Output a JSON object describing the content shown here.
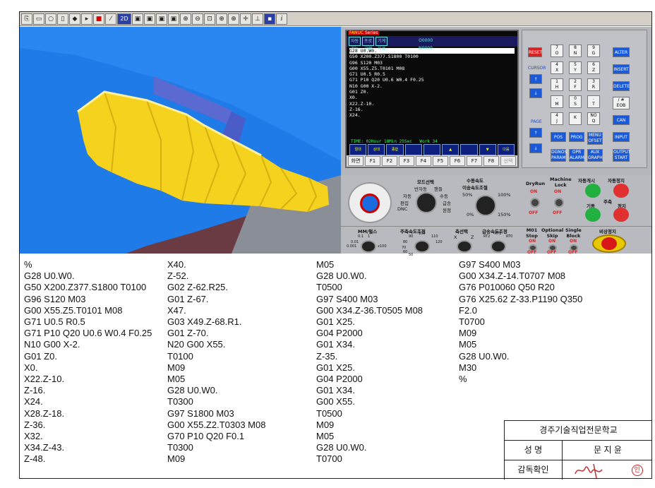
{
  "toolbar": {
    "icons": [
      "open-icon",
      "save-icon",
      "rotate-icon",
      "material-icon",
      "tool-icon",
      "play-icon",
      "stop-icon",
      "reset-icon",
      "2d-icon",
      "view-top-icon",
      "view-front-icon",
      "view-side-icon",
      "view-iso-icon",
      "zoom-in-icon",
      "zoom-out-icon",
      "zoom-window-icon",
      "zoom-fit-icon",
      "zoom-all-icon",
      "pan-icon",
      "axis-icon",
      "color-icon",
      "info-icon"
    ],
    "label_2d": "2D"
  },
  "nc_screen": {
    "brand": "FANUC",
    "brand_series": "Series",
    "tabs": [
      "자동\n기능",
      "프로\n그램",
      "기계\n자료",
      "O0000\nN0000"
    ],
    "program_lines": [
      "G28 U0.W0.",
      "G50 X200.Z377.S1800 T0100",
      "G96 S120 M03",
      "G00 X55.Z5.T0101 M08",
      "G71 U0.5 R0.5",
      "G71 P10 Q20 U0.6 W0.4 F0.25",
      "N10 G00 X-2.",
      "G01 Z0.",
      "X0.",
      "X22.Z-10.",
      "Z-16.",
      "X24."
    ],
    "time_line": "TIME: 02Hour 18Min 25Sec   Work 34",
    "status_line": "[   ][   ][   ][   ]",
    "softkeys": [
      "절대",
      "상대",
      "종합",
      "",
      "",
      "▲",
      "",
      "▼",
      "다음\n프로그램"
    ],
    "fkeys": [
      "화면",
      "F1",
      "F2",
      "F3",
      "F4",
      "F5",
      "F6",
      "F7",
      "F8",
      "선택"
    ]
  },
  "keypad": {
    "reset": "RESET",
    "cursor": "CURSOR",
    "page": "PAGE",
    "alter": "ALTER",
    "insert": "INSERT",
    "delete": "DELETE",
    "eob": "/ #\nEOB",
    "can": "CAN",
    "input": "INPUT",
    "output": "OUTPUT\nSTART",
    "pos": "POS",
    "prog": "PROG",
    "menu": "MENU\nOFSET",
    "dgnos": "DGNOS\nPARAM",
    "opr": "OPR\nALARM",
    "aux": "AUX\nGRAPH",
    "keys": [
      "7\nO",
      "8\nN",
      "9\nG",
      "4\nX",
      "5\nY",
      "6\nZ",
      "1\nH",
      "2\nF",
      "3\nR",
      "-\nM",
      "0\nS",
      ".\nT",
      "4\nJ",
      "K",
      "NO\nQ",
      "←",
      "→",
      "↑",
      "↓"
    ]
  },
  "panel": {
    "mode_select": "모드선택",
    "manual_speed": "수동속도\n이송속도조절",
    "dryrun": "DryRun",
    "machine_lock": "Machine\nLock",
    "auto_start": "자동개시",
    "auto_stop": "자동정지",
    "on": "ON",
    "off": "OFF",
    "spindle": "기동",
    "spindle_label": "주축",
    "stop": "정지",
    "mm_pulse": "MM/펄스",
    "spindle_override": "주축속도조정",
    "axis_select": "축선택",
    "rapid_override": "급송속도조정",
    "m01_stop": "M01\nStop",
    "optional_skip": "Optional\nSkip",
    "single_block": "Single\nBlock",
    "emergency": "비상정지",
    "mode_labels": [
      "반자동",
      "핸들",
      "자동",
      "수동",
      "편집",
      "급송",
      "DNC",
      "원점"
    ],
    "percent_labels": [
      "50%",
      "100%",
      "0%",
      "150%"
    ],
    "mm_labels": [
      "0.1",
      "1",
      "0.01",
      "0.001",
      "x100"
    ],
    "spindle_labels": [
      "100",
      "90",
      "110",
      "80",
      "120",
      "70",
      "60",
      "50"
    ],
    "axis_labels": [
      "X",
      "Z"
    ],
    "rapid_labels": [
      "RT2",
      "RT1",
      "RT0"
    ]
  },
  "program": {
    "col1": [
      "%",
      "G28 U0.W0.",
      "G50 X200.Z377.S1800 T0100",
      "G96 S120 M03",
      "G00 X55.Z5.T0101 M08",
      "G71 U0.5 R0.5",
      "G71 P10 Q20 U0.6 W0.4 F0.25",
      "N10 G00 X-2.",
      "G01 Z0.",
      "X0.",
      "X22.Z-10.",
      "Z-16.",
      "X24.",
      "X28.Z-18.",
      "Z-36.",
      "X32.",
      "X34.Z-43.",
      "Z-48."
    ],
    "col2": [
      "X40.",
      "Z-52.",
      "G02 Z-62.R25.",
      "G01 Z-67.",
      "X47.",
      "G03 X49.Z-68.R1.",
      "G01 Z-70.",
      "N20 G00 X55.",
      "T0100",
      "M09",
      "M05",
      "G28 U0.W0.",
      "T0300",
      "G97 S1800 M03",
      "G00 X55.Z2.T0303 M08",
      "G70 P10 Q20 F0.1",
      "T0300",
      "M09"
    ],
    "col3": [
      "M05",
      "G28 U0.W0.",
      "T0500",
      "G97 S400 M03",
      "G00 X34.Z-36.T0505 M08",
      "G01 X25.",
      "G04 P2000",
      "G01 X34.",
      "Z-35.",
      "G01 X25.",
      "G04 P2000",
      "G01 X34.",
      "G00 X55.",
      "T0500",
      "M09",
      "M05",
      "G28 U0.W0.",
      "T0700"
    ],
    "col4": [
      "G97 S400 M03",
      "G00 X34.Z-14.T0707 M08",
      "G76 P010060 Q50 R20",
      "G76 X25.62 Z-33.P1190 Q350",
      "F2.0",
      "T0700",
      "M09",
      "M05",
      "G28 U0.W0.",
      "M30",
      "%"
    ]
  },
  "stamp": {
    "school": "경주기술직업전문학교",
    "name_label": "성  명",
    "name_value": "문 지 윤",
    "supervisor_label": "감독확인",
    "seal_char": "인"
  },
  "colors": {
    "viewport_bg": "#ffffff",
    "workpiece": "#f5d21e",
    "chuck": "#1e78e6",
    "fixture": "#6a3a40"
  }
}
